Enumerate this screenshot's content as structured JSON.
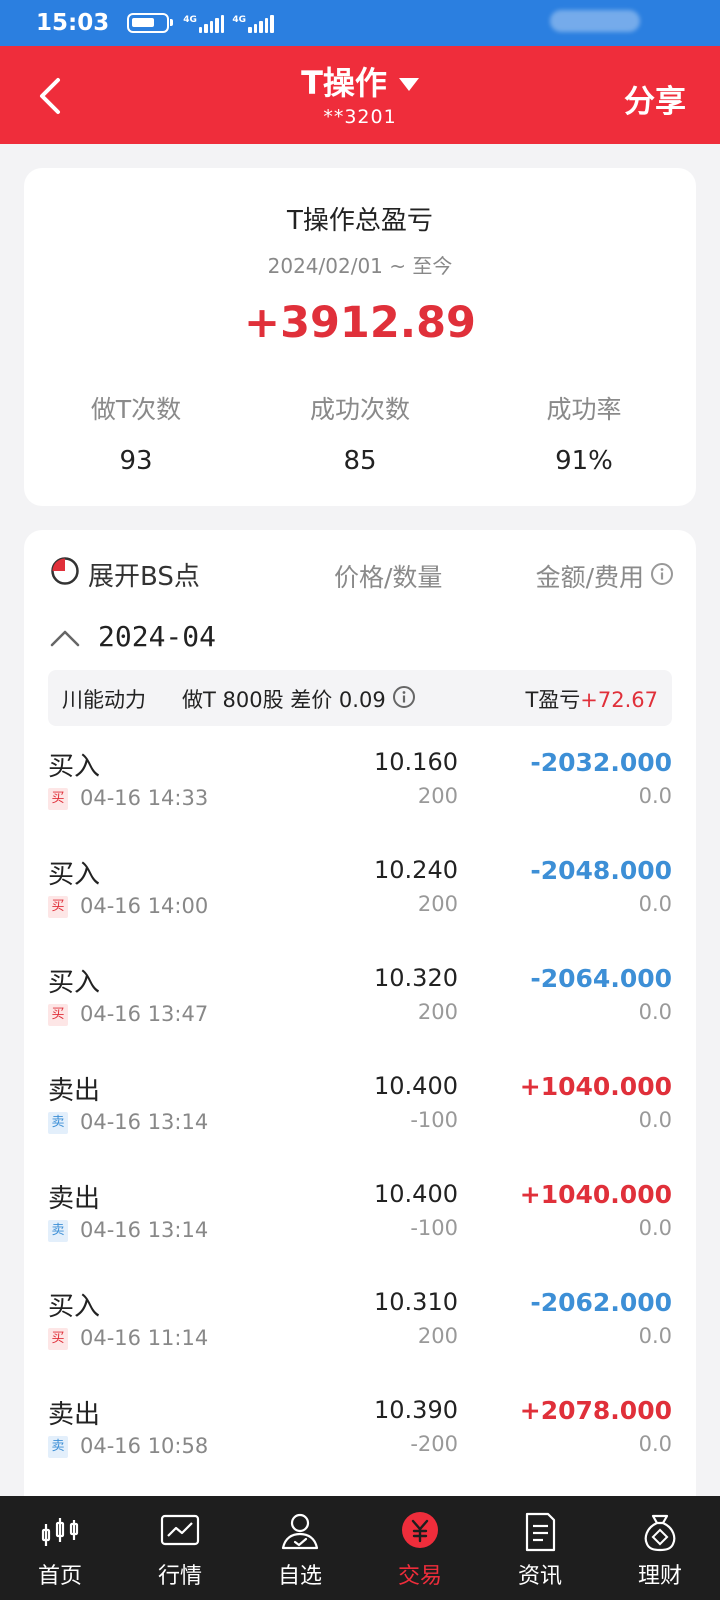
{
  "status_bar": {
    "time": "15:03",
    "net1": "4G",
    "net2": "4G"
  },
  "header": {
    "title": "T操作",
    "account": "**3201",
    "share": "分享",
    "color": "#ef2d3b"
  },
  "summary": {
    "title": "T操作总盈亏",
    "range": "2024/02/01 ~ 至今",
    "total": "+3912.89",
    "stats": [
      {
        "label": "做T次数",
        "value": "93"
      },
      {
        "label": "成功次数",
        "value": "85"
      },
      {
        "label": "成功率",
        "value": "91%"
      }
    ]
  },
  "detail": {
    "toggle": "展开BS点",
    "col_price": "价格/数量",
    "col_amount": "金额/费用",
    "month": "2024-04",
    "group": {
      "stock": "川能动力",
      "info": "做T 800股 差价 0.09",
      "pnl_label": "T盈亏",
      "pnl_value": "+72.67"
    },
    "transactions": [
      {
        "type": "买入",
        "badge": "买",
        "side": "buy",
        "time": "04-16 14:33",
        "price": "10.160",
        "qty": "200",
        "amount": "-2032.000",
        "fee": "0.0"
      },
      {
        "type": "买入",
        "badge": "买",
        "side": "buy",
        "time": "04-16 14:00",
        "price": "10.240",
        "qty": "200",
        "amount": "-2048.000",
        "fee": "0.0"
      },
      {
        "type": "买入",
        "badge": "买",
        "side": "buy",
        "time": "04-16 13:47",
        "price": "10.320",
        "qty": "200",
        "amount": "-2064.000",
        "fee": "0.0"
      },
      {
        "type": "卖出",
        "badge": "卖",
        "side": "sell",
        "time": "04-16 13:14",
        "price": "10.400",
        "qty": "-100",
        "amount": "+1040.000",
        "fee": "0.0"
      },
      {
        "type": "卖出",
        "badge": "卖",
        "side": "sell",
        "time": "04-16 13:14",
        "price": "10.400",
        "qty": "-100",
        "amount": "+1040.000",
        "fee": "0.0"
      },
      {
        "type": "买入",
        "badge": "买",
        "side": "buy",
        "time": "04-16 11:14",
        "price": "10.310",
        "qty": "200",
        "amount": "-2062.000",
        "fee": "0.0"
      },
      {
        "type": "卖出",
        "badge": "卖",
        "side": "sell",
        "time": "04-16 10:58",
        "price": "10.390",
        "qty": "-200",
        "amount": "+2078.000",
        "fee": "0.0"
      }
    ]
  },
  "nav": {
    "items": [
      {
        "label": "首页",
        "icon": "candlestick-icon"
      },
      {
        "label": "行情",
        "icon": "chart-icon"
      },
      {
        "label": "自选",
        "icon": "user-check-icon"
      },
      {
        "label": "交易",
        "icon": "yen-icon",
        "active": true
      },
      {
        "label": "资讯",
        "icon": "document-icon"
      },
      {
        "label": "理财",
        "icon": "money-bag-icon"
      }
    ]
  },
  "colors": {
    "positive": "#e0303a",
    "negative": "#3d8fd6",
    "status_bar": "#2b7fe0"
  }
}
